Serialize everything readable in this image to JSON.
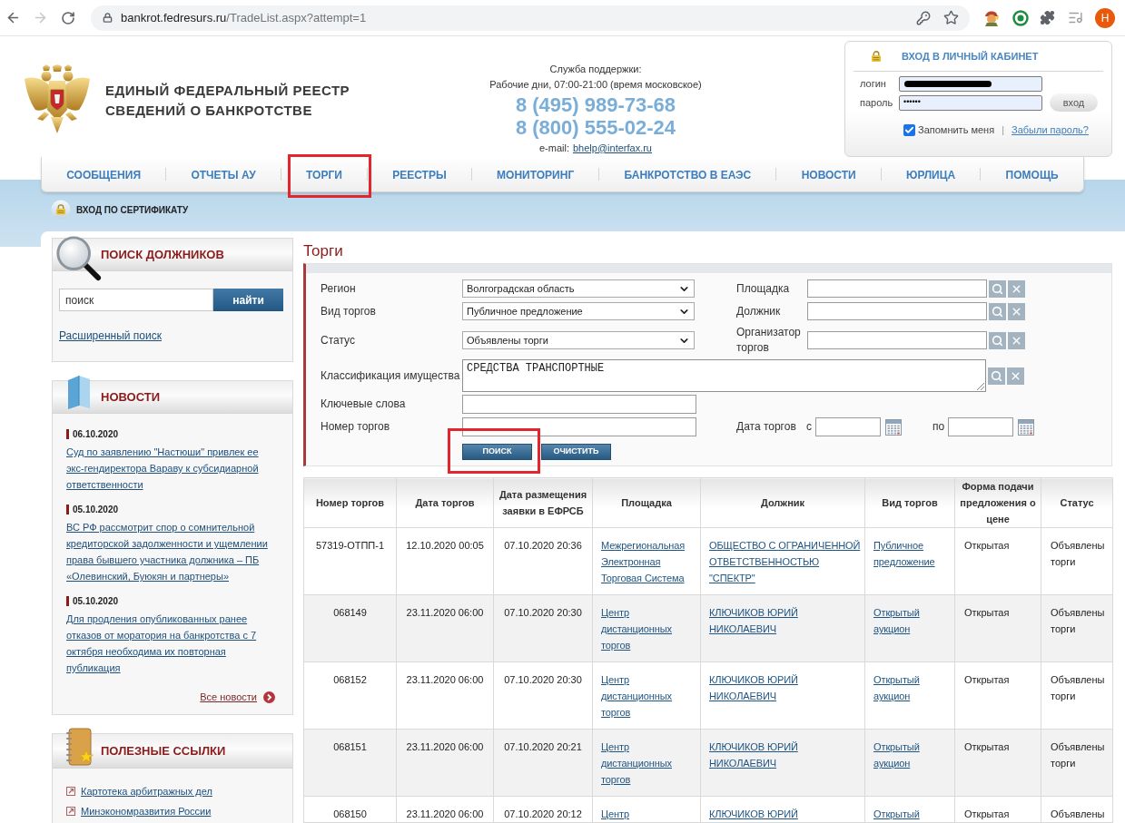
{
  "browser": {
    "url": {
      "host": "bankrot.fedresurs.ru",
      "path": "/TradeList.aspx?attempt=1"
    },
    "forward_disabled": true,
    "profile_initial": "Н"
  },
  "header": {
    "title_lines": [
      "ЕДИНЫЙ ФЕДЕРАЛЬНЫЙ РЕЕСТР",
      "СВЕДЕНИЙ О БАНКРОТСТВЕ"
    ],
    "support": {
      "title": "Служба поддержки:",
      "hours": "Рабочие дни, 07:00-21:00 (время московское)",
      "phones": [
        "8 (495) 989-73-68",
        "8 (800) 555-02-24"
      ],
      "email_label": "e-mail:",
      "email": "bhelp@interfax.ru"
    }
  },
  "login": {
    "title": "ВХОД В ЛИЧНЫЙ КАБИНЕТ",
    "login_label": "логин",
    "login_redacted": true,
    "password_label": "пароль",
    "password_value": "••••••",
    "submit": "вход",
    "remember": {
      "label": "Запомнить меня",
      "checked": true
    },
    "separator": "|",
    "forgot": "Забыли пароль?"
  },
  "nav": [
    {
      "label": "СООБЩЕНИЯ",
      "highlighted": false
    },
    {
      "label": "ОТЧЕТЫ АУ",
      "highlighted": false
    },
    {
      "label": "ТОРГИ",
      "highlighted": true
    },
    {
      "label": "РЕЕСТРЫ",
      "highlighted": false
    },
    {
      "label": "МОНИТОРИНГ",
      "highlighted": false
    },
    {
      "label": "БАНКРОТСТВО В ЕАЭС",
      "highlighted": false
    },
    {
      "label": "НОВОСТИ",
      "highlighted": false
    },
    {
      "label": "ЮРЛИЦА",
      "highlighted": false
    },
    {
      "label": "ПОМОЩЬ",
      "highlighted": false
    }
  ],
  "certificate_login": "ВХОД ПО СЕРТИФИКАТУ",
  "sidebar": {
    "debtor_search": {
      "title": "ПОИСК ДОЛЖНИКОВ",
      "value": "поиск",
      "button": "найти",
      "advanced": "Расширенный поиск"
    },
    "news": {
      "title": "НОВОСТИ",
      "items": [
        {
          "date": "06.10.2020",
          "text": "Суд по заявлению \"Настюши\" привлек ее экс-гендиректора Вараву к субсидиарной ответственности"
        },
        {
          "date": "05.10.2020",
          "text": "ВС РФ рассмотрит спор о сомнительной кредиторской задолженности и ущемлении права бывшего участника должника – ПБ «Олевинский, Буюкян и партнеры»"
        },
        {
          "date": "05.10.2020",
          "text": "Для продления опубликованных ранее отказов от моратория на банкротства с 7 октября необходима их повторная публикация"
        }
      ],
      "all": "Все новости"
    },
    "links": {
      "title": "ПОЛЕЗНЫЕ ССЫЛКИ",
      "items": [
        "Картотека арбитражных дел",
        "Минэкономразвития России"
      ]
    }
  },
  "main": {
    "title": "Торги",
    "filter_rows": [
      [
        {
          "kind": "select",
          "label": "Регион",
          "value": "Волгоградская область"
        },
        {
          "kind": "lookup",
          "label": "Площадка"
        }
      ],
      [
        {
          "kind": "select",
          "label": "Вид торгов",
          "value": "Публичное предложение"
        },
        {
          "kind": "lookup",
          "label": "Должник"
        }
      ],
      [
        {
          "kind": "select",
          "label": "Статус",
          "value": "Объявлены торги"
        },
        {
          "kind": "lookup",
          "label": "Организатор торгов"
        }
      ],
      [
        {
          "kind": "lookup_area",
          "label": "Классификация имущества",
          "value": "СРЕДСТВА ТРАНСПОРТНЫЕ"
        }
      ],
      [
        {
          "kind": "text",
          "label": "Ключевые слова"
        }
      ],
      [
        {
          "kind": "text",
          "label": "Номер торгов"
        },
        {
          "kind": "date_range",
          "label": "Дата торгов",
          "from_label": "с",
          "to_label": "по"
        }
      ]
    ],
    "buttons": [
      {
        "label": "ПОИСК",
        "highlighted": true
      },
      {
        "label": "ОЧИСТИТЬ",
        "highlighted": false
      }
    ],
    "table": {
      "columns": [
        {
          "label": "Номер торгов",
          "kind": "center"
        },
        {
          "label": "Дата торгов",
          "kind": "center"
        },
        {
          "label": "Дата размещения заявки в ЕФРСБ",
          "kind": "center"
        },
        {
          "label": "Площадка",
          "kind": "link"
        },
        {
          "label": "Должник",
          "kind": "link"
        },
        {
          "label": "Вид торгов",
          "kind": "link"
        },
        {
          "label": "Форма подачи предложения о цене",
          "kind": "plain"
        },
        {
          "label": "Статус",
          "kind": "plain"
        }
      ],
      "rows": [
        {
          "cells": [
            "57319-ОТПП-1",
            "12.10.2020 00:05",
            "07.10.2020 20:36",
            "Межрегиональная Электронная Торговая Система",
            "ОБЩЕСТВО С ОГРАНИЧЕННОЙ ОТВЕТСТВЕННОСТЬЮ \"СПЕКТР\"",
            "Публичное предложение",
            "Открытая",
            "Объявлены торги"
          ]
        },
        {
          "cells": [
            "068149",
            "23.11.2020 06:00",
            "07.10.2020 20:30",
            "Центр дистанционных торгов",
            "КЛЮЧИКОВ ЮРИЙ НИКОЛАЕВИЧ",
            "Открытый аукцион",
            "Открытая",
            "Объявлены торги"
          ]
        },
        {
          "cells": [
            "068152",
            "23.11.2020 06:00",
            "07.10.2020 20:30",
            "Центр дистанционных торгов",
            "КЛЮЧИКОВ ЮРИЙ НИКОЛАЕВИЧ",
            "Открытый аукцион",
            "Открытая",
            "Объявлены торги"
          ]
        },
        {
          "cells": [
            "068151",
            "23.11.2020 06:00",
            "07.10.2020 20:21",
            "Центр дистанционных торгов",
            "КЛЮЧИКОВ ЮРИЙ НИКОЛАЕВИЧ",
            "Открытый аукцион",
            "Открытая",
            "Объявлены торги"
          ]
        },
        {
          "cells": [
            "068150",
            "23.11.2020 06:00",
            "07.10.2020 20:12",
            "Центр",
            "КЛЮЧИКОВ ЮРИЙ",
            "Открытый",
            "Открытая",
            "Объявлены"
          ]
        }
      ]
    }
  }
}
